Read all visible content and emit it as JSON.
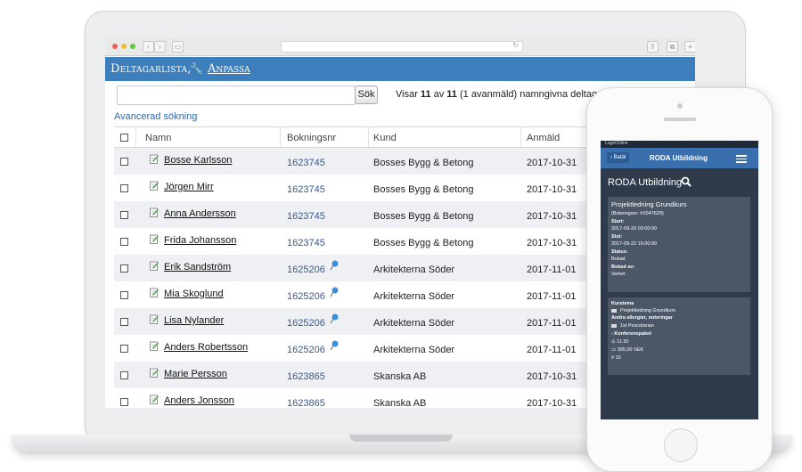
{
  "browser": {
    "address_icon": "reload-icon"
  },
  "app": {
    "title": "Deltagarlista,",
    "customize_label": "Anpassa",
    "wrench_icon": "wrench-icon"
  },
  "search": {
    "placeholder": "",
    "button_label": "Sök",
    "result_prefix": "Visar ",
    "result_shown": "11",
    "result_mid": " av ",
    "result_total": "11",
    "result_suffix": " (1 avanmäld) namngivna deltagare",
    "advanced_label": "Avancerad sökning"
  },
  "table": {
    "columns": [
      "Namn",
      "Bokningsnr",
      "Kund",
      "Anmäld"
    ],
    "rows": [
      {
        "name": "Bosse Karlsson",
        "bokningsnr": "1623745",
        "kund": "Bosses Bygg & Betong",
        "anmald": "2017-10-31",
        "pin": false
      },
      {
        "name": "Jörgen Mirr",
        "bokningsnr": "1623745",
        "kund": "Bosses Bygg & Betong",
        "anmald": "2017-10-31",
        "pin": false
      },
      {
        "name": "Anna Andersson",
        "bokningsnr": "1623745",
        "kund": "Bosses Bygg & Betong",
        "anmald": "2017-10-31",
        "pin": false
      },
      {
        "name": "Frida Johansson",
        "bokningsnr": "1623745",
        "kund": "Bosses Bygg & Betong",
        "anmald": "2017-10-31",
        "pin": false
      },
      {
        "name": "Erik Sandström",
        "bokningsnr": "1625206",
        "kund": "Arkitekterna Söder",
        "anmald": "2017-11-01",
        "pin": true
      },
      {
        "name": "Mia Skoglund",
        "bokningsnr": "1625206",
        "kund": "Arkitekterna Söder",
        "anmald": "2017-11-01",
        "pin": true
      },
      {
        "name": "Lisa Nylander",
        "bokningsnr": "1625206",
        "kund": "Arkitekterna Söder",
        "anmald": "2017-11-01",
        "pin": true
      },
      {
        "name": "Anders Robertsson",
        "bokningsnr": "1625206",
        "kund": "Arkitekterna Söder",
        "anmald": "2017-11-01",
        "pin": true
      },
      {
        "name": "Marie Persson",
        "bokningsnr": "1623865",
        "kund": "Skanska AB",
        "anmald": "2017-10-31",
        "pin": false
      },
      {
        "name": "Anders Jonsson",
        "bokningsnr": "1623865",
        "kund": "Skanska AB",
        "anmald": "2017-10-31",
        "pin": false
      }
    ]
  },
  "phone": {
    "status_brand": "LogeOnline",
    "back_label": "Batäl",
    "nav_title": "RODA Utbildning",
    "page_title": "RODA Utbildning",
    "card1": {
      "title": "Projektledning Grundkurs",
      "booking": "(Bokningsnr: #1047620)",
      "start_label": "Start:",
      "start_value": "2017-09-20 09:00:00",
      "end_label": "Slut:",
      "end_value": "2017-09-22 16:00:00",
      "status_label": "Status:",
      "status_value": "Bokad",
      "booked_by_label": "Bokad av:",
      "booked_by_value": "Verket"
    },
    "card2": {
      "theme_label": "Kurstema",
      "theme_value": "Projektledning Grundkurs",
      "allergy_label": "Andra allergier, noteringar",
      "allergy_value": "1st Pescetarian",
      "package_label": "- Konferenspaket",
      "time_value": "11:30",
      "price_value": "395,00 SEK",
      "count_value": "10"
    }
  },
  "colors": {
    "header_blue": "#3c7fbc",
    "link_blue": "#2a6ab5",
    "phone_bg": "#2f3b4a",
    "phone_card": "#4b5766"
  }
}
